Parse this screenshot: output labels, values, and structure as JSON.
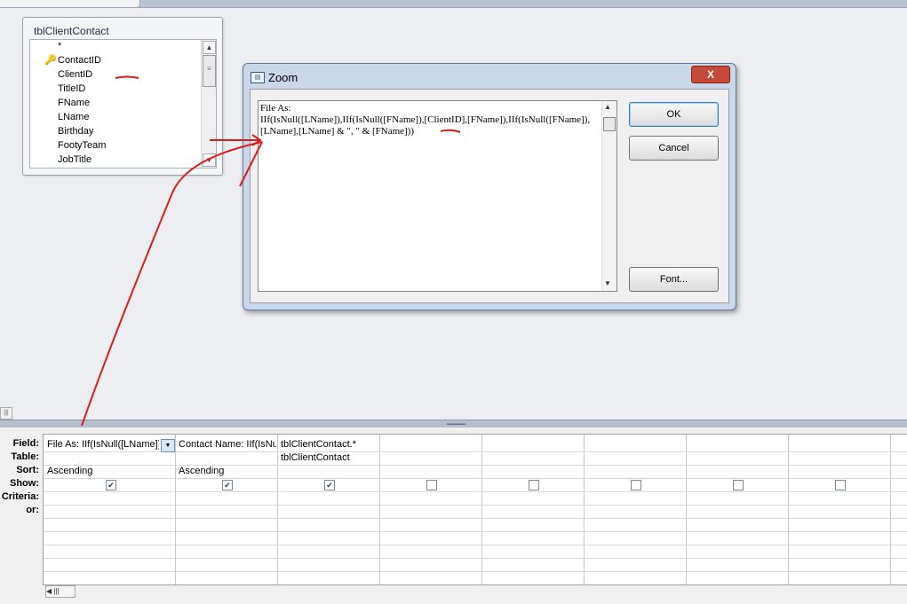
{
  "table": {
    "title": "tblClientContact",
    "fields": [
      "*",
      "ContactID",
      "ClientID",
      "TitleID",
      "FName",
      "LName",
      "Birthday",
      "FootyTeam",
      "JobTitle"
    ],
    "key_field": "ContactID"
  },
  "zoom": {
    "title": "Zoom",
    "expression_line1": "File As:",
    "expression_line2": "IIf(IsNull([LName]),IIf(IsNull([FName]),[ClientID],[FName]),IIf(IsNull([FName]),",
    "expression_line3": "[LName],[LName] & \", \" & [FName]))",
    "ok_label": "OK",
    "cancel_label": "Cancel",
    "font_label": "Font...",
    "close_label": "X"
  },
  "grid": {
    "row_labels": [
      "Field:",
      "Table:",
      "Sort:",
      "Show:",
      "Criteria:",
      "or:"
    ],
    "columns": [
      {
        "field": "File As: IIf(IsNull([LName])",
        "table": "",
        "sort": "Ascending",
        "show": true
      },
      {
        "field": "Contact Name: IIf(IsNu",
        "table": "",
        "sort": "Ascending",
        "show": true
      },
      {
        "field": "tblClientContact.*",
        "table": "tblClientContact",
        "sort": "",
        "show": true
      },
      {
        "field": "",
        "table": "",
        "sort": "",
        "show": false
      },
      {
        "field": "",
        "table": "",
        "sort": "",
        "show": false
      },
      {
        "field": "",
        "table": "",
        "sort": "",
        "show": false
      },
      {
        "field": "",
        "table": "",
        "sort": "",
        "show": false
      },
      {
        "field": "",
        "table": "",
        "sort": "",
        "show": false
      }
    ]
  },
  "colors": {
    "annotation": "#d81e1e",
    "title_bar": "#c9d7e8",
    "close_button": "#c64a3a"
  }
}
